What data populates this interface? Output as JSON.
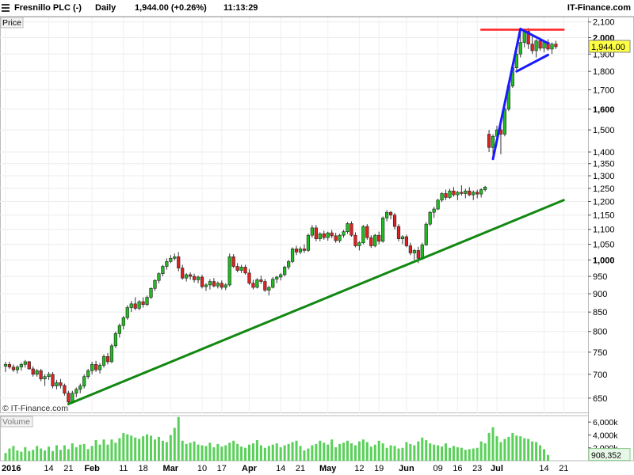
{
  "header": {
    "instrument": "Fresnillo PLC (-)",
    "interval": "Daily",
    "quote": "1,944.00 (+0.26%)",
    "time": "11:13:29",
    "brand": "IT-Finance.com"
  },
  "price_panel_label": "Price",
  "volume_panel_label": "Volume",
  "watermark": "© IT-Finance.com",
  "last_price_tag": "1,944.00",
  "last_volume_tag": "908,352",
  "colors": {
    "up": "#22bb22",
    "down": "#dd2222",
    "trend": "#118811",
    "resistance": "#ff2222",
    "pattern": "#1a1aff",
    "volume": "#5ad05a"
  },
  "chart_data": [
    {
      "type": "candlestick",
      "title": "Fresnillo PLC (-)",
      "y_scale": "log",
      "ylim": [
        620,
        2130
      ],
      "y_ticks": [
        "2,100",
        "2,000",
        "1,900",
        "1,800",
        "1,700",
        "1,600",
        "1,500",
        "1,400",
        "1,350",
        "1,300",
        "1,250",
        "1,200",
        "1,150",
        "1,100",
        "1,050",
        "1,000",
        "950",
        "900",
        "850",
        "800",
        "750",
        "700",
        "650"
      ],
      "y_tick_values": [
        2100,
        2000,
        1900,
        1800,
        1700,
        1600,
        1500,
        1400,
        1350,
        1300,
        1250,
        1200,
        1150,
        1100,
        1050,
        1000,
        950,
        900,
        850,
        800,
        750,
        700,
        650
      ],
      "y_bold_ticks": [
        "2,000",
        "1,600",
        "1,000"
      ],
      "x_labels": [
        "2016",
        "14",
        "21",
        "Feb",
        "11",
        "18",
        "Mar",
        "10",
        "17",
        "Apr",
        "14",
        "21",
        "May",
        "12",
        "19",
        "Jun",
        "09",
        "16",
        "23",
        "Jul",
        "14",
        "21"
      ],
      "x_bold_labels": [
        "2016",
        "Feb",
        "Mar",
        "Apr",
        "May",
        "Jun",
        "Jul"
      ],
      "x_label_index": [
        0,
        11,
        16,
        22,
        30,
        35,
        42,
        50,
        55,
        62,
        70,
        75,
        82,
        90,
        95,
        102,
        110,
        115,
        120,
        125,
        137,
        142
      ],
      "last_price": 1944,
      "candles": [
        [
          718,
          728,
          705,
          722
        ],
        [
          722,
          728,
          712,
          716
        ],
        [
          716,
          722,
          705,
          710
        ],
        [
          710,
          720,
          702,
          716
        ],
        [
          716,
          726,
          708,
          722
        ],
        [
          722,
          732,
          715,
          728
        ],
        [
          728,
          730,
          710,
          712
        ],
        [
          712,
          718,
          695,
          700
        ],
        [
          700,
          712,
          695,
          708
        ],
        [
          708,
          712,
          685,
          690
        ],
        [
          690,
          700,
          675,
          695
        ],
        [
          695,
          705,
          688,
          700
        ],
        [
          700,
          705,
          670,
          675
        ],
        [
          675,
          688,
          668,
          682
        ],
        [
          682,
          690,
          670,
          676
        ],
        [
          676,
          680,
          655,
          660
        ],
        [
          660,
          665,
          638,
          642
        ],
        [
          642,
          665,
          640,
          660
        ],
        [
          660,
          672,
          652,
          668
        ],
        [
          668,
          680,
          660,
          675
        ],
        [
          675,
          700,
          670,
          695
        ],
        [
          695,
          712,
          690,
          708
        ],
        [
          708,
          728,
          700,
          722
        ],
        [
          722,
          730,
          705,
          710
        ],
        [
          710,
          725,
          702,
          720
        ],
        [
          720,
          745,
          715,
          740
        ],
        [
          740,
          748,
          722,
          728
        ],
        [
          728,
          770,
          725,
          765
        ],
        [
          765,
          800,
          760,
          795
        ],
        [
          795,
          820,
          785,
          815
        ],
        [
          815,
          840,
          805,
          835
        ],
        [
          835,
          868,
          830,
          862
        ],
        [
          862,
          880,
          850,
          872
        ],
        [
          872,
          890,
          855,
          860
        ],
        [
          860,
          882,
          855,
          878
        ],
        [
          878,
          890,
          862,
          870
        ],
        [
          870,
          895,
          866,
          890
        ],
        [
          890,
          918,
          885,
          915
        ],
        [
          915,
          942,
          908,
          938
        ],
        [
          938,
          962,
          930,
          958
        ],
        [
          958,
          985,
          950,
          980
        ],
        [
          980,
          1005,
          970,
          995
        ],
        [
          995,
          1015,
          990,
          1005
        ],
        [
          1005,
          1020,
          998,
          1010
        ],
        [
          1010,
          1025,
          965,
          975
        ],
        [
          975,
          985,
          940,
          945
        ],
        [
          945,
          960,
          935,
          955
        ],
        [
          955,
          962,
          940,
          950
        ],
        [
          950,
          958,
          932,
          940
        ],
        [
          940,
          952,
          930,
          948
        ],
        [
          948,
          955,
          915,
          920
        ],
        [
          920,
          930,
          908,
          925
        ],
        [
          925,
          942,
          912,
          935
        ],
        [
          935,
          945,
          918,
          922
        ],
        [
          922,
          935,
          915,
          930
        ],
        [
          930,
          938,
          912,
          918
        ],
        [
          918,
          930,
          910,
          925
        ],
        [
          925,
          1020,
          920,
          1010
        ],
        [
          1010,
          1018,
          975,
          980
        ],
        [
          980,
          990,
          962,
          968
        ],
        [
          968,
          985,
          960,
          978
        ],
        [
          978,
          985,
          955,
          960
        ],
        [
          960,
          972,
          925,
          930
        ],
        [
          930,
          940,
          912,
          918
        ],
        [
          918,
          945,
          915,
          940
        ],
        [
          940,
          952,
          928,
          935
        ],
        [
          935,
          942,
          905,
          910
        ],
        [
          910,
          922,
          895,
          918
        ],
        [
          918,
          948,
          915,
          942
        ],
        [
          942,
          952,
          930,
          948
        ],
        [
          948,
          960,
          938,
          955
        ],
        [
          955,
          982,
          950,
          978
        ],
        [
          978,
          1000,
          970,
          995
        ],
        [
          995,
          1040,
          990,
          1035
        ],
        [
          1035,
          1045,
          1015,
          1025
        ],
        [
          1025,
          1042,
          1018,
          1035
        ],
        [
          1035,
          1050,
          1022,
          1030
        ],
        [
          1030,
          1085,
          1025,
          1080
        ],
        [
          1080,
          1115,
          1072,
          1105
        ],
        [
          1105,
          1115,
          1060,
          1068
        ],
        [
          1068,
          1090,
          1060,
          1085
        ],
        [
          1085,
          1095,
          1065,
          1072
        ],
        [
          1072,
          1092,
          1062,
          1088
        ],
        [
          1088,
          1098,
          1070,
          1078
        ],
        [
          1078,
          1088,
          1055,
          1062
        ],
        [
          1062,
          1085,
          1055,
          1080
        ],
        [
          1080,
          1098,
          1072,
          1092
        ],
        [
          1092,
          1125,
          1085,
          1120
        ],
        [
          1120,
          1128,
          1075,
          1080
        ],
        [
          1080,
          1090,
          1040,
          1045
        ],
        [
          1045,
          1060,
          1030,
          1055
        ],
        [
          1055,
          1115,
          1050,
          1110
        ],
        [
          1110,
          1118,
          1065,
          1072
        ],
        [
          1072,
          1080,
          1038,
          1045
        ],
        [
          1045,
          1085,
          1040,
          1080
        ],
        [
          1080,
          1092,
          1050,
          1060
        ],
        [
          1060,
          1145,
          1055,
          1140
        ],
        [
          1140,
          1168,
          1128,
          1160
        ],
        [
          1160,
          1165,
          1135,
          1150
        ],
        [
          1150,
          1158,
          1100,
          1110
        ],
        [
          1110,
          1118,
          1060,
          1068
        ],
        [
          1068,
          1080,
          1050,
          1075
        ],
        [
          1075,
          1082,
          1040,
          1045
        ],
        [
          1045,
          1055,
          1015,
          1022
        ],
        [
          1022,
          1035,
          1000,
          1030
        ],
        [
          1030,
          1042,
          990,
          1005
        ],
        [
          1005,
          1055,
          1000,
          1048
        ],
        [
          1048,
          1125,
          1045,
          1118
        ],
        [
          1118,
          1165,
          1112,
          1160
        ],
        [
          1160,
          1180,
          1140,
          1172
        ],
        [
          1172,
          1210,
          1168,
          1205
        ],
        [
          1205,
          1235,
          1198,
          1230
        ],
        [
          1230,
          1245,
          1205,
          1215
        ],
        [
          1215,
          1248,
          1210,
          1240
        ],
        [
          1240,
          1255,
          1218,
          1225
        ],
        [
          1225,
          1240,
          1205,
          1235
        ],
        [
          1235,
          1262,
          1222,
          1230
        ],
        [
          1230,
          1248,
          1212,
          1240
        ],
        [
          1240,
          1255,
          1220,
          1225
        ],
        [
          1225,
          1242,
          1205,
          1235
        ],
        [
          1235,
          1245,
          1212,
          1228
        ],
        [
          1228,
          1250,
          1215,
          1245
        ],
        [
          1245,
          1260,
          1238,
          1255
        ],
        [
          1480,
          1500,
          1400,
          1420
        ],
        [
          1420,
          1480,
          1370,
          1470
        ],
        [
          1470,
          1520,
          1430,
          1500
        ],
        [
          1500,
          1530,
          1390,
          1480
        ],
        [
          1480,
          1620,
          1470,
          1600
        ],
        [
          1600,
          1740,
          1590,
          1720
        ],
        [
          1720,
          1850,
          1710,
          1820
        ],
        [
          1820,
          1920,
          1810,
          1900
        ],
        [
          1900,
          2030,
          1880,
          1970
        ],
        [
          1970,
          2050,
          1940,
          2040
        ],
        [
          2040,
          2060,
          1930,
          1960
        ],
        [
          1960,
          2010,
          1900,
          1920
        ],
        [
          1920,
          1990,
          1880,
          1980
        ],
        [
          1980,
          2000,
          1920,
          1935
        ],
        [
          1935,
          1980,
          1910,
          1970
        ],
        [
          1970,
          1990,
          1920,
          1930
        ],
        [
          1930,
          1970,
          1900,
          1960
        ],
        [
          1960,
          1980,
          1930,
          1944
        ]
      ]
    },
    {
      "type": "bar",
      "title": "Volume",
      "y_ticks": [
        "6,000k",
        "4,000k",
        "2,000k"
      ],
      "y_tick_values": [
        6000,
        4000,
        2000
      ],
      "ylim": [
        0,
        7000
      ],
      "last_value": "908,352",
      "values": [
        1200,
        1900,
        2300,
        1600,
        1400,
        2100,
        1500,
        1700,
        2300,
        1900,
        1600,
        2200,
        1500,
        2400,
        1700,
        2400,
        1800,
        2700,
        2100,
        2500,
        2600,
        1800,
        2300,
        3200,
        2500,
        3300,
        2500,
        3300,
        2800,
        3500,
        4300,
        4100,
        3900,
        3600,
        3400,
        3800,
        4100,
        3900,
        3300,
        3700,
        3100,
        2900,
        4000,
        5100,
        6800,
        3100,
        2600,
        2800,
        3000,
        2500,
        2400,
        2300,
        2800,
        2100,
        2600,
        2200,
        2400,
        2800,
        3100,
        2600,
        2200,
        2000,
        2500,
        2700,
        3200,
        2400,
        2000,
        2300,
        2500,
        2700,
        2100,
        2400,
        2600,
        2900,
        3100,
        2300,
        1600,
        1900,
        2400,
        2600,
        3100,
        2800,
        2500,
        3300,
        2100,
        2600,
        2800,
        3100,
        2700,
        2400,
        3000,
        3300,
        2900,
        2200,
        2500,
        3100,
        2700,
        2000,
        2400,
        2300,
        1900,
        2000,
        2900,
        2600,
        2400,
        3000,
        3600,
        3200,
        2700,
        2500,
        2400,
        2200,
        2700,
        2000,
        2300,
        2100,
        2000,
        1700,
        1800,
        1900,
        2000,
        3000,
        2700,
        4300,
        5200,
        3800,
        2900,
        3400,
        3700,
        4300,
        3900,
        3800,
        3500,
        3400,
        3000,
        2900,
        2400,
        1800,
        900
      ]
    }
  ]
}
